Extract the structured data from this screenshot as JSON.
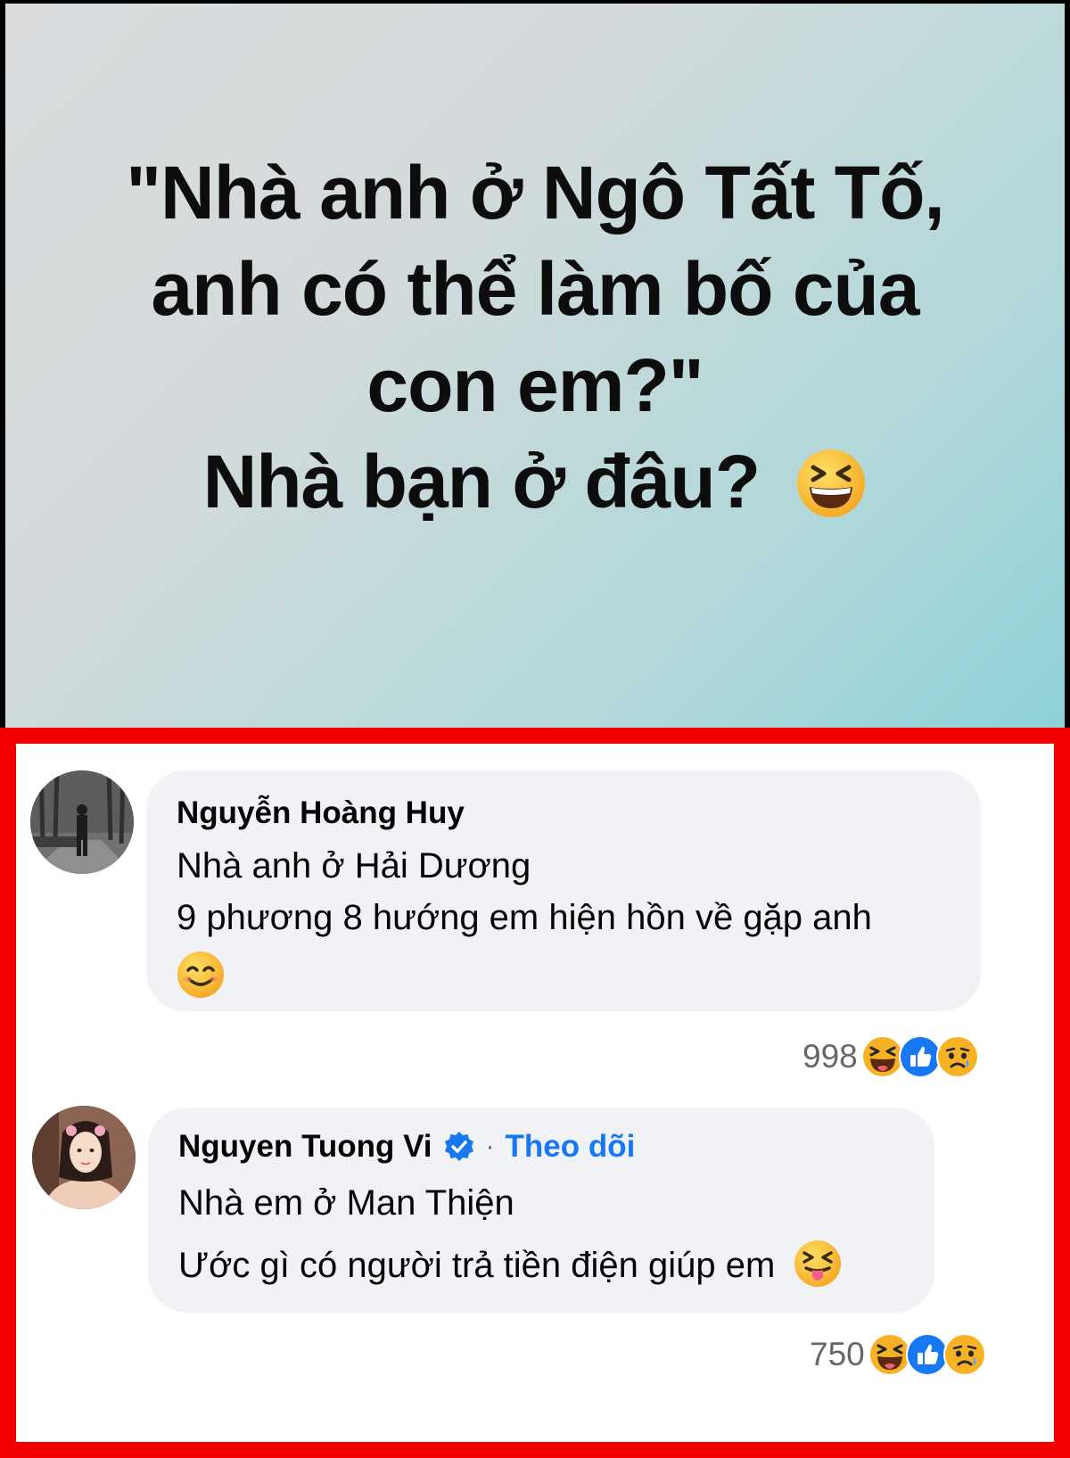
{
  "post": {
    "lines": [
      "\"Nhà anh ở Ngô Tất Tố,",
      "anh có thể làm bố của",
      "con em?\"",
      "Nhà bạn ở đâu?"
    ],
    "trailing_emoji": "laughing-squint-emoji"
  },
  "comments": [
    {
      "author": "Nguyễn Hoàng Huy",
      "verified": false,
      "lines": [
        "Nhà anh ở Hải Dương",
        "9 phương 8 hướng em hiện hồn về gặp anh"
      ],
      "trailing_emoji": "smiling-face-emoji",
      "reaction_count": "998",
      "reactions": [
        "haha-reaction-icon",
        "like-reaction-icon",
        "sad-reaction-icon"
      ]
    },
    {
      "author": "Nguyen Tuong Vi",
      "verified": true,
      "separator": "·",
      "follow_label": "Theo dõi",
      "lines": [
        "Nhà em ở Man Thiện",
        "Ước gì có người trả tiền điện giúp em"
      ],
      "trailing_emoji": "tongue-squint-emoji",
      "reaction_count": "750",
      "reactions": [
        "haha-reaction-icon",
        "like-reaction-icon",
        "sad-reaction-icon"
      ]
    }
  ],
  "colors": {
    "highlight_border": "#f40000",
    "bubble_bg": "#f0f2f5",
    "follow_link": "#1877f2",
    "muted_text": "#65676b"
  }
}
